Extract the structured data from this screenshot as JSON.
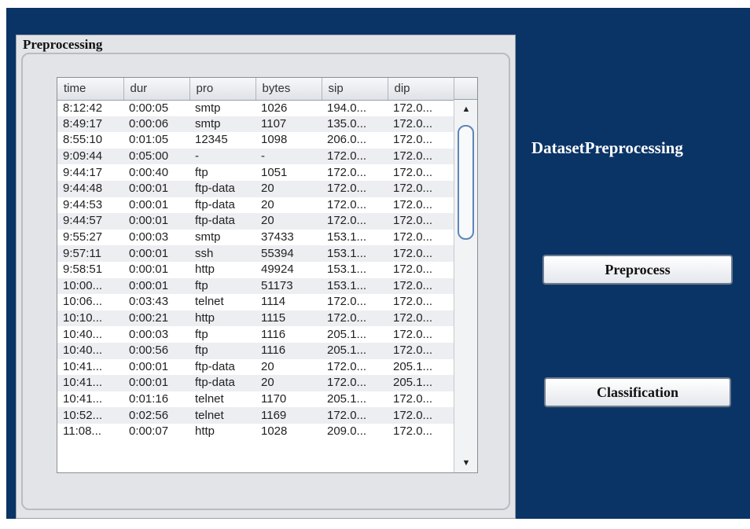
{
  "panel": {
    "title": "Preprocessing"
  },
  "table": {
    "columns": [
      "time",
      "dur",
      "pro",
      "bytes",
      "sip",
      "dip"
    ],
    "rows": [
      [
        "8:12:42",
        "0:00:05",
        "smtp",
        "1026",
        "194.0...",
        "172.0..."
      ],
      [
        "8:49:17",
        "0:00:06",
        "smtp",
        "1107",
        "135.0...",
        "172.0..."
      ],
      [
        "8:55:10",
        "0:01:05",
        "12345",
        "1098",
        "206.0...",
        "172.0..."
      ],
      [
        "9:09:44",
        "0:05:00",
        "-",
        "-",
        "172.0...",
        "172.0..."
      ],
      [
        "9:44:17",
        "0:00:40",
        "ftp",
        "1051",
        "172.0...",
        "172.0..."
      ],
      [
        "9:44:48",
        "0:00:01",
        "ftp-data",
        "20",
        "172.0...",
        "172.0..."
      ],
      [
        "9:44:53",
        "0:00:01",
        "ftp-data",
        "20",
        "172.0...",
        "172.0..."
      ],
      [
        "9:44:57",
        "0:00:01",
        "ftp-data",
        "20",
        "172.0...",
        "172.0..."
      ],
      [
        "9:55:27",
        "0:00:03",
        "smtp",
        "37433",
        "153.1...",
        "172.0..."
      ],
      [
        "9:57:11",
        "0:00:01",
        "ssh",
        "55394",
        "153.1...",
        "172.0..."
      ],
      [
        "9:58:51",
        "0:00:01",
        "http",
        "49924",
        "153.1...",
        "172.0..."
      ],
      [
        "10:00...",
        "0:00:01",
        "ftp",
        "51173",
        "153.1...",
        "172.0..."
      ],
      [
        "10:06...",
        "0:03:43",
        "telnet",
        "1114",
        "172.0...",
        "172.0..."
      ],
      [
        "10:10...",
        "0:00:21",
        "http",
        "1115",
        "172.0...",
        "172.0..."
      ],
      [
        "10:40...",
        "0:00:03",
        "ftp",
        "1116",
        "205.1...",
        "172.0..."
      ],
      [
        "10:40...",
        "0:00:56",
        "ftp",
        "1116",
        "205.1...",
        "172.0..."
      ],
      [
        "10:41...",
        "0:00:01",
        "ftp-data",
        "20",
        "172.0...",
        "205.1..."
      ],
      [
        "10:41...",
        "0:00:01",
        "ftp-data",
        "20",
        "172.0...",
        "205.1..."
      ],
      [
        "10:41...",
        "0:01:16",
        "telnet",
        "1170",
        "205.1...",
        "172.0..."
      ],
      [
        "10:52...",
        "0:02:56",
        "telnet",
        "1169",
        "172.0...",
        "172.0..."
      ],
      [
        "11:08...",
        "0:00:07",
        "http",
        "1028",
        "209.0...",
        "172.0..."
      ]
    ]
  },
  "scroll_icons": {
    "up": "scroll-up-arrow-icon",
    "down": "scroll-down-arrow-icon"
  },
  "sidebar": {
    "title": "DatasetPreprocessing",
    "preprocess_label": "Preprocess",
    "classification_label": "Classification"
  },
  "colors": {
    "background": "#0b3466",
    "panel": "#e2e4e7"
  }
}
